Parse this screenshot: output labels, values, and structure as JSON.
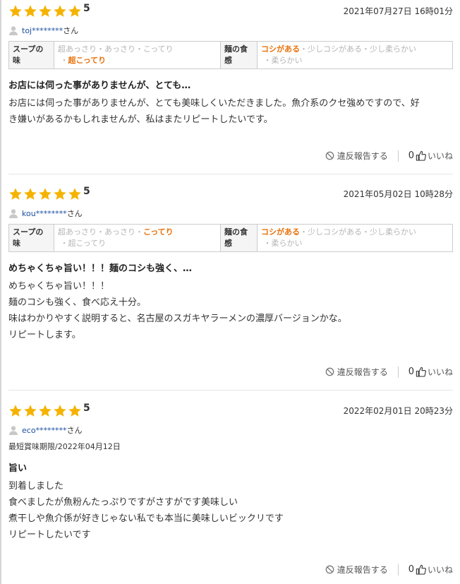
{
  "colors": {
    "star": "#f5b301",
    "selected": "#e8710a",
    "unselected": "#b5b5b5",
    "user": "#1a4fa0"
  },
  "labels": {
    "soup": "スープの味",
    "noodle": "麺の食感",
    "report": "違反報告する",
    "like": "いいね",
    "san": "さん"
  },
  "reviews": [
    {
      "score": "5",
      "date": "2021年07月27日 16時01分",
      "user": "toj********",
      "soup": [
        {
          "text": "超あっさり",
          "selected": false
        },
        {
          "text": "あっさり",
          "selected": false
        },
        {
          "text": "こってり",
          "selected": false
        },
        {
          "text": "超こってり",
          "selected": true
        }
      ],
      "noodle": [
        {
          "text": "コシがある",
          "selected": true
        },
        {
          "text": "少しコシがある",
          "selected": false
        },
        {
          "text": "少し柔らかい",
          "selected": false
        },
        {
          "text": "柔らかい",
          "selected": false
        }
      ],
      "title": "お店には伺った事がありませんが、とても…",
      "body": [
        "お店には伺った事がありませんが、とても美味しくいただきました。魚介系のクセ強めですので、好",
        "き嫌いがあるかもしれませんが、私はまたリピートしたいです。"
      ],
      "likes": "0"
    },
    {
      "score": "5",
      "date": "2021年05月02日 10時28分",
      "user": "kou********",
      "soup": [
        {
          "text": "超あっさり",
          "selected": false
        },
        {
          "text": "あっさり",
          "selected": false
        },
        {
          "text": "こってり",
          "selected": true
        },
        {
          "text": "超こってり",
          "selected": false
        }
      ],
      "noodle": [
        {
          "text": "コシがある",
          "selected": true
        },
        {
          "text": "少しコシがある",
          "selected": false
        },
        {
          "text": "少し柔らかい",
          "selected": false
        },
        {
          "text": "柔らかい",
          "selected": false
        }
      ],
      "title": "めちゃくちゃ旨い！！！麺のコシも強く、…",
      "body": [
        "めちゃくちゃ旨い！！！",
        "麺のコシも強く、食べ応え十分。",
        "味はわかりやすく説明すると、名古屋のスガキヤラーメンの濃厚バージョンかな。",
        "リピートします。"
      ],
      "likes": "0"
    },
    {
      "score": "5",
      "date": "2022年02月01日 20時23分",
      "user": "eco********",
      "expiry": "最短賞味期限/2022年04月12日",
      "title": "旨い",
      "body": [
        "到着しました",
        "食べましたが魚粉んたっぷりですがさすがです美味しい",
        "煮干しや魚介係が好きじゃない私でも本当に美味しいビックリです",
        "リピートしたいです"
      ],
      "likes": "0"
    }
  ]
}
